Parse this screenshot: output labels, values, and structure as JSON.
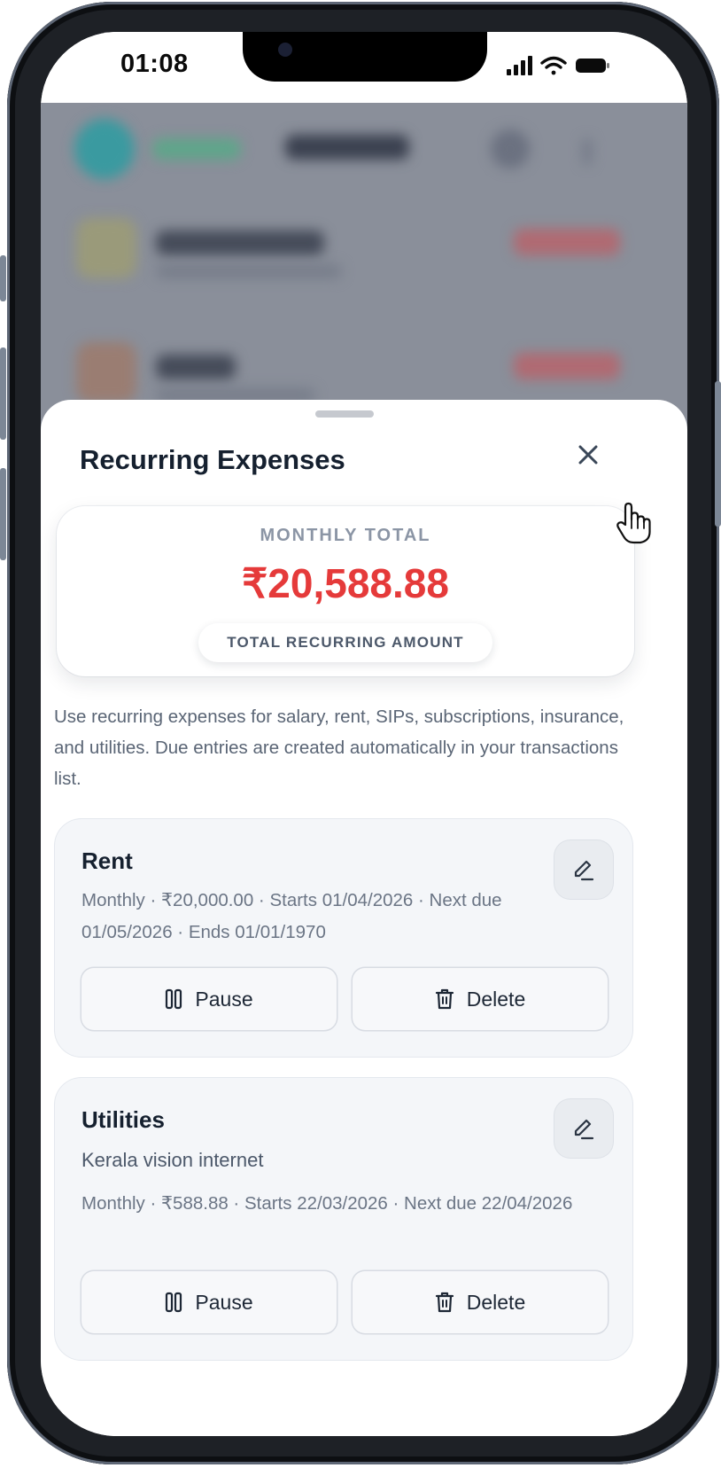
{
  "status_bar": {
    "time": "01:08"
  },
  "sheet": {
    "title": "Recurring Expenses",
    "close_icon": "close-icon"
  },
  "summary": {
    "label": "MONTHLY TOTAL",
    "amount": "₹20,588.88",
    "badge": "TOTAL RECURRING AMOUNT",
    "amount_color": "#e53a3a"
  },
  "hint": "Use recurring expenses for salary, rent, SIPs, subscriptions, insurance, and utilities. Due entries are created automatically in your transactions list.",
  "items": [
    {
      "title": "Rent",
      "meta": "Monthly · ₹20,000.00 · Starts 01/04/2026 · Next due 01/05/2026 · Ends 01/01/1970",
      "pause_label": "Pause",
      "delete_label": "Delete"
    },
    {
      "title": "Utilities",
      "note": "Kerala vision internet",
      "meta": "Monthly · ₹588.88 · Starts 22/03/2026 · Next due 22/04/2026",
      "pause_label": "Pause",
      "delete_label": "Delete"
    }
  ]
}
